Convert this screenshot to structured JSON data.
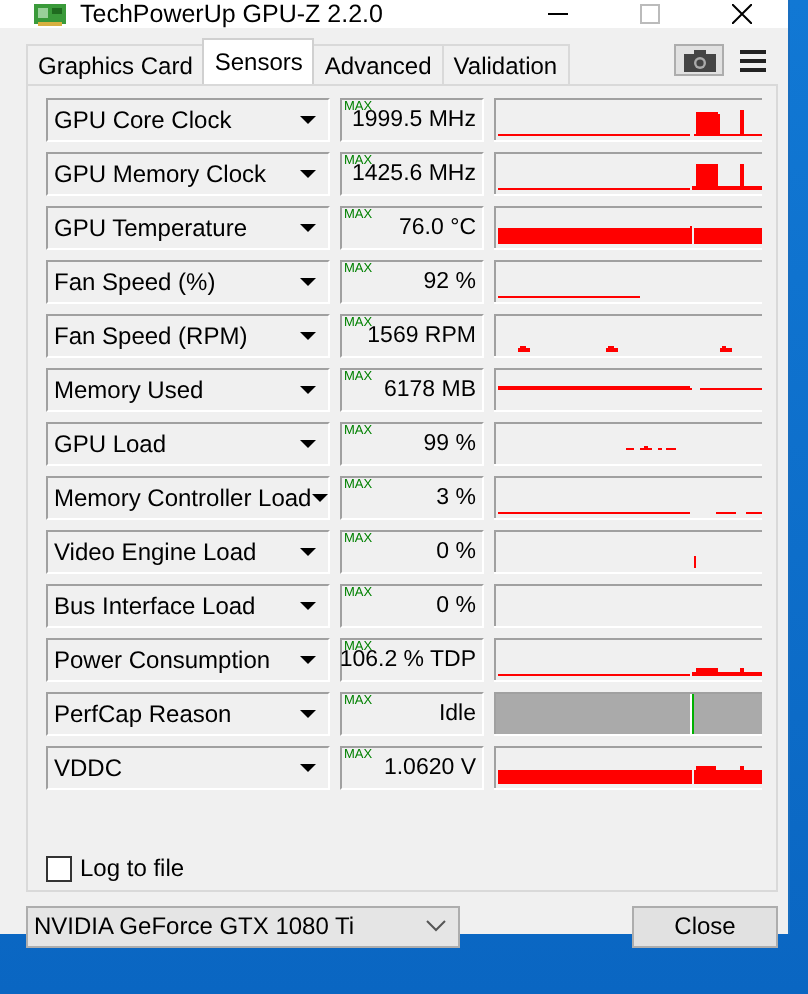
{
  "window": {
    "title": "TechPowerUp GPU-Z 2.2.0"
  },
  "tabs": [
    {
      "label": "Graphics Card",
      "selected": false
    },
    {
      "label": "Sensors",
      "selected": true
    },
    {
      "label": "Advanced",
      "selected": false
    },
    {
      "label": "Validation",
      "selected": false
    }
  ],
  "sensors": [
    {
      "name": "GPU Core Clock",
      "max_label": "MAX",
      "value": "1999.5 MHz",
      "kind": "graph"
    },
    {
      "name": "GPU Memory Clock",
      "max_label": "MAX",
      "value": "1425.6 MHz",
      "kind": "graph"
    },
    {
      "name": "GPU Temperature",
      "max_label": "MAX",
      "value": "76.0 °C",
      "kind": "graph"
    },
    {
      "name": "Fan Speed (%)",
      "max_label": "MAX",
      "value": "92 %",
      "kind": "graph"
    },
    {
      "name": "Fan Speed (RPM)",
      "max_label": "MAX",
      "value": "1569 RPM",
      "kind": "graph"
    },
    {
      "name": "Memory Used",
      "max_label": "MAX",
      "value": "6178 MB",
      "kind": "graph"
    },
    {
      "name": "GPU Load",
      "max_label": "MAX",
      "value": "99 %",
      "kind": "graph"
    },
    {
      "name": "Memory Controller Load",
      "max_label": "MAX",
      "value": "3 %",
      "kind": "graph"
    },
    {
      "name": "Video Engine Load",
      "max_label": "MAX",
      "value": "0 %",
      "kind": "graph"
    },
    {
      "name": "Bus Interface Load",
      "max_label": "MAX",
      "value": "0 %",
      "kind": "graph"
    },
    {
      "name": "Power Consumption",
      "max_label": "MAX",
      "value": "106.2 % TDP",
      "kind": "graph"
    },
    {
      "name": "PerfCap Reason",
      "max_label": "MAX",
      "value": "Idle",
      "kind": "status"
    },
    {
      "name": "VDDC",
      "max_label": "MAX",
      "value": "1.0620 V",
      "kind": "graph"
    }
  ],
  "log_to_file": {
    "label": "Log to file",
    "checked": false
  },
  "gpu_select": {
    "value": "NVIDIA GeForce GTX 1080 Ti"
  },
  "close_button": {
    "label": "Close"
  }
}
